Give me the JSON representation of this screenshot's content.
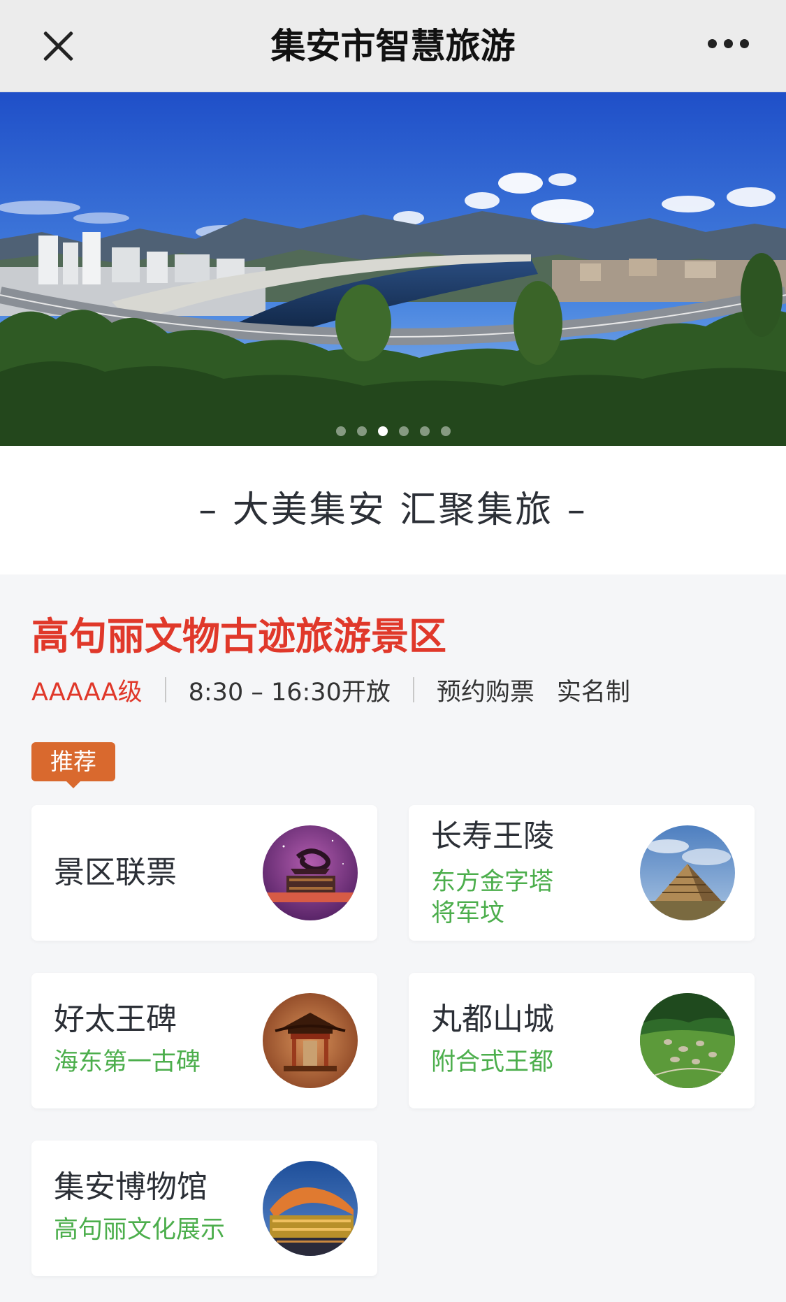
{
  "nav": {
    "title": "集安市智慧旅游",
    "close_icon": "close-icon",
    "more_icon": "more-dots-icon"
  },
  "banner": {
    "slides": 6,
    "active_index": 2
  },
  "slogan": "– 大美集安  汇聚集旅 –",
  "scenic": {
    "title": "高句丽文物古迹旅游景区",
    "level": "AAAAA级",
    "hours": "8:30 – 16:30开放",
    "booking": "预约购票",
    "realname": "实名制"
  },
  "tag": "推荐",
  "cards": [
    {
      "title": "景区联票",
      "sub1": "",
      "sub2": ""
    },
    {
      "title": "长寿王陵",
      "sub1": "东方金字塔",
      "sub2": "将军坟"
    },
    {
      "title": "好太王碑",
      "sub1": "海东第一古碑",
      "sub2": ""
    },
    {
      "title": "丸都山城",
      "sub1": "附合式王都",
      "sub2": ""
    },
    {
      "title": "集安博物馆",
      "sub1": "高句丽文化展示",
      "sub2": ""
    }
  ],
  "colors": {
    "accent_red": "#e0382a",
    "accent_green": "#4cae4c",
    "tag_orange": "#d9692e"
  }
}
